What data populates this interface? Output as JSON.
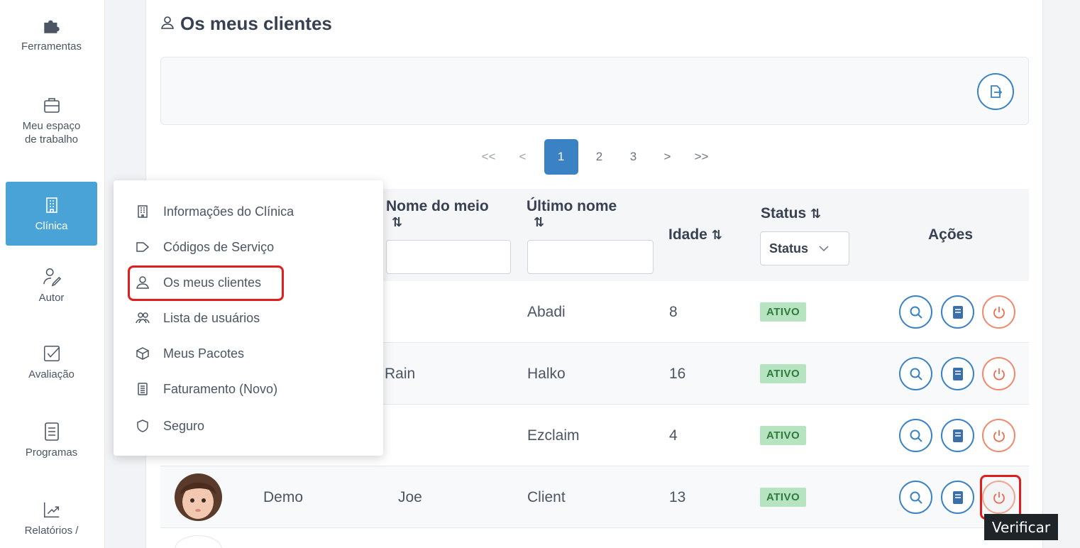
{
  "sidebar": {
    "items": [
      {
        "label": "Ferramentas",
        "icon": "puzzle-icon"
      },
      {
        "label": "Meu espaço de trabalho",
        "icon": "briefcase-icon"
      },
      {
        "label": "Clínica",
        "icon": "building-icon"
      },
      {
        "label": "Autor",
        "icon": "user-pen-icon"
      },
      {
        "label": "Avaliação",
        "icon": "checkbox-icon"
      },
      {
        "label": "Programas",
        "icon": "document-icon"
      },
      {
        "label": "Relatórios /",
        "icon": "chart-icon"
      }
    ]
  },
  "page": {
    "title": "Os meus clientes"
  },
  "pagination": {
    "first": "<<",
    "prev": "<",
    "pages": [
      "1",
      "2",
      "3"
    ],
    "current": "1",
    "next": ">",
    "last": ">>"
  },
  "table": {
    "columns": {
      "middle_name": "Nome do meio",
      "last_name": "Último nome",
      "age": "Idade",
      "status": "Status",
      "actions": "Ações"
    },
    "sort_glyph": "⇅",
    "status_filter": "Status",
    "rows": [
      {
        "first": "",
        "middle": "",
        "last": "Abadi",
        "age": "8",
        "status": "ATIVO"
      },
      {
        "first": "",
        "middle": "Rain",
        "last": "Halko",
        "age": "16",
        "status": "ATIVO"
      },
      {
        "first": "",
        "middle": "",
        "last": "Ezclaim",
        "age": "4",
        "status": "ATIVO"
      },
      {
        "first": "Demo",
        "middle": "Joe",
        "last": "Client",
        "age": "13",
        "status": "ATIVO"
      }
    ]
  },
  "menu": {
    "items": [
      {
        "label": "Informações do Clínica",
        "icon": "building-icon"
      },
      {
        "label": "Códigos de Serviço",
        "icon": "tag-icon"
      },
      {
        "label": "Os meus clientes",
        "icon": "user-icon"
      },
      {
        "label": "Lista de usuários",
        "icon": "users-icon"
      },
      {
        "label": "Meus Pacotes",
        "icon": "box-icon"
      },
      {
        "label": "Faturamento (Novo)",
        "icon": "receipt-icon"
      },
      {
        "label": "Seguro",
        "icon": "shield-icon"
      }
    ]
  },
  "tooltip": "Verificar",
  "colors": {
    "primary": "#3b82c4",
    "sidebar_active": "#4aa3d6",
    "badge_bg": "#b7e4c0",
    "power": "#ef8a6f",
    "highlight": "#e11d1d"
  }
}
